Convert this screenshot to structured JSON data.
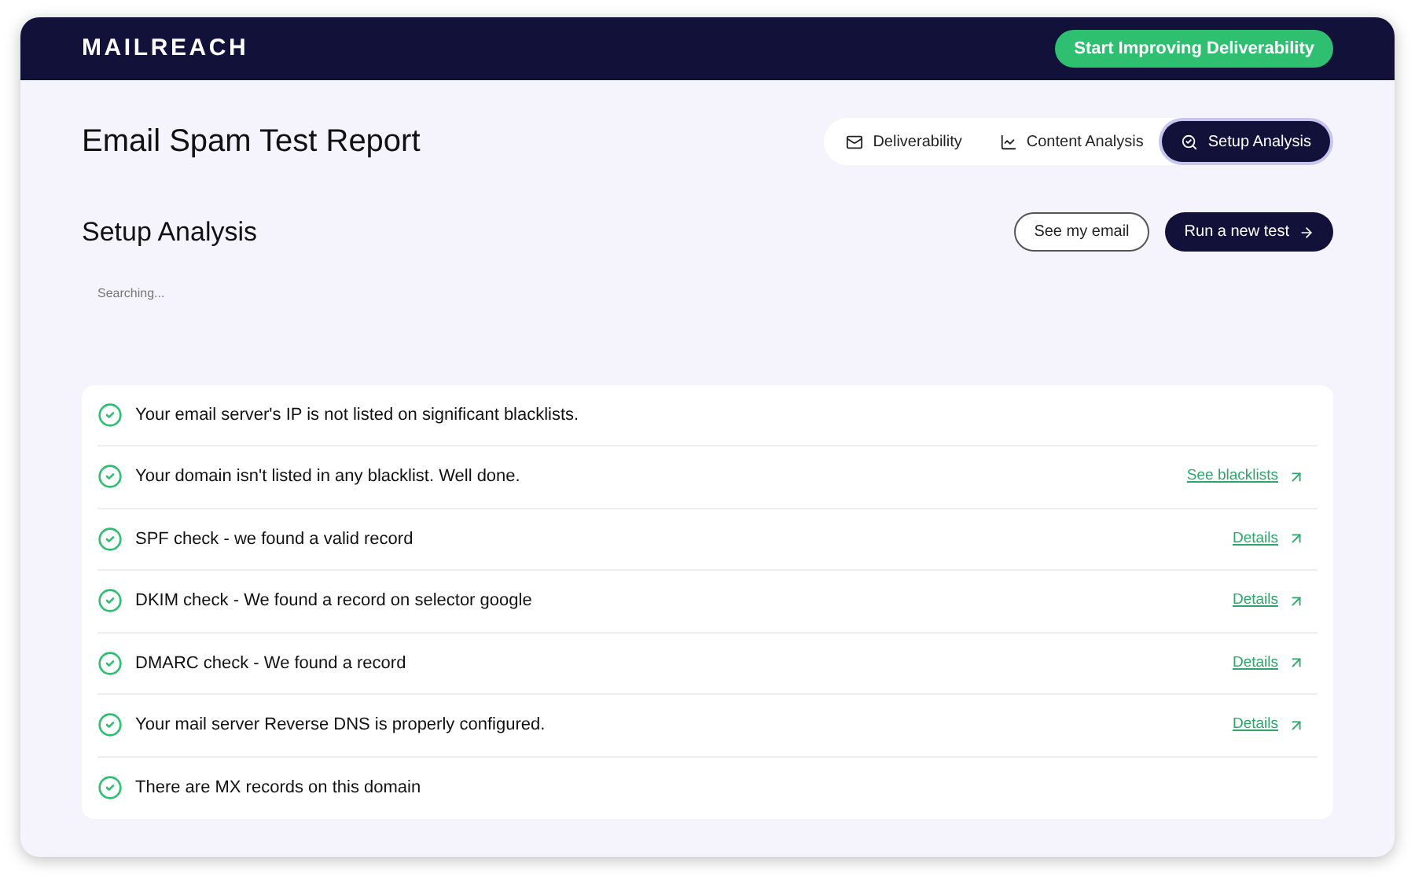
{
  "header": {
    "logo": "MAILREACH",
    "cta": "Start Improving Deliverability"
  },
  "page": {
    "title": "Email Spam Test Report"
  },
  "tabs": [
    {
      "label": "Deliverability",
      "kind": "mail",
      "selected": false
    },
    {
      "label": "Content Analysis",
      "kind": "chart",
      "selected": false
    },
    {
      "label": "Setup Analysis",
      "kind": "search",
      "selected": true
    }
  ],
  "section": {
    "title": "Setup Analysis",
    "buttons": [
      {
        "label": "See my email",
        "kind": "outline"
      },
      {
        "label": "Run a new test",
        "kind": "primary"
      }
    ],
    "status": "Searching..."
  },
  "checks": [
    {
      "text": "Your email server's IP is not listed on significant blacklists.",
      "passed": true
    },
    {
      "text": "Your domain isn't listed in any blacklist. Well done.",
      "passed": true,
      "link": "See blacklists"
    },
    {
      "text": "SPF check - we found a valid record",
      "passed": true,
      "link": "Details"
    },
    {
      "text": "DKIM check - We found a record on selector google",
      "passed": true,
      "link": "Details"
    },
    {
      "text": "DMARC check - We found a record",
      "passed": true,
      "link": "Details"
    },
    {
      "text": "Your mail server Reverse DNS is properly configured.",
      "passed": true,
      "link": "Details"
    },
    {
      "text": "There are MX records on this domain",
      "passed": true
    }
  ]
}
